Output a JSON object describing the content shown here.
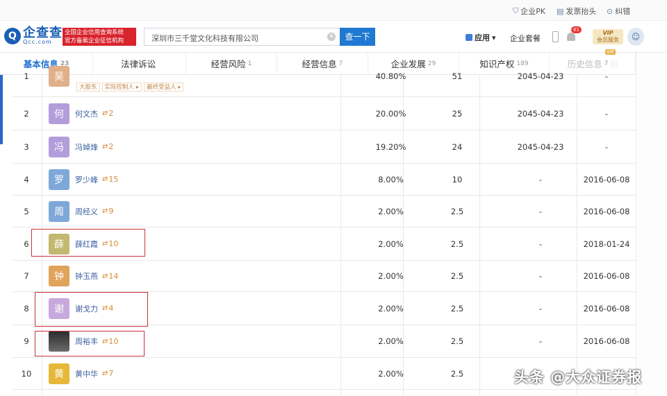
{
  "topbar": {
    "links": [
      {
        "label": "企业PK",
        "icon": "pk-icon"
      },
      {
        "label": "发票抬头",
        "icon": "invoice-icon"
      },
      {
        "label": "纠错",
        "icon": "correction-icon"
      }
    ]
  },
  "header": {
    "logo_main": "企查查",
    "logo_sub": "Qcc.com",
    "badge_line1": "全国企业信用查询系统",
    "badge_line2": "官方备案企业征信机构",
    "search_value": "深圳市三千堂文化科技有限公司",
    "search_button": "查一下",
    "app_label": "应用",
    "package_label": "企业套餐",
    "bell_count": "61",
    "vip_label": "VIP",
    "vip_sub": "会员服务"
  },
  "tabs": [
    {
      "label": "基本信息",
      "count": "23",
      "active": true
    },
    {
      "label": "法律诉讼",
      "count": ""
    },
    {
      "label": "经营风险",
      "count": "1"
    },
    {
      "label": "经营信息",
      "count": "7"
    },
    {
      "label": "企业发展",
      "count": "29"
    },
    {
      "label": "知识产权",
      "count": "189"
    },
    {
      "label": "历史信息",
      "count": "7",
      "vip": "VIP"
    }
  ],
  "rows": [
    {
      "index": "1",
      "avatar_char": "吴",
      "name": "",
      "relations": "",
      "percent": "40.80%",
      "amount": "51",
      "date1": "2045-04-23",
      "date2": "-",
      "tags": [
        "大股东",
        "实际控制人 ▸",
        "最终受益人 ▸"
      ]
    },
    {
      "index": "2",
      "avatar_char": "何",
      "name": "何文杰",
      "relations": "2",
      "percent": "20.00%",
      "amount": "25",
      "date1": "2045-04-23",
      "date2": "-"
    },
    {
      "index": "3",
      "avatar_char": "冯",
      "name": "冯婥烽",
      "relations": "2",
      "percent": "19.20%",
      "amount": "24",
      "date1": "2045-04-23",
      "date2": "-"
    },
    {
      "index": "4",
      "avatar_char": "罗",
      "name": "罗少峰",
      "relations": "15",
      "percent": "8.00%",
      "amount": "10",
      "date1": "-",
      "date2": "2016-06-08"
    },
    {
      "index": "5",
      "avatar_char": "周",
      "name": "周经义",
      "relations": "9",
      "percent": "2.00%",
      "amount": "2.5",
      "date1": "-",
      "date2": "2016-06-08"
    },
    {
      "index": "6",
      "avatar_char": "薛",
      "name": "薛红霞",
      "relations": "10",
      "percent": "2.00%",
      "amount": "2.5",
      "date1": "-",
      "date2": "2018-01-24"
    },
    {
      "index": "7",
      "avatar_char": "钟",
      "name": "钟玉燕",
      "relations": "14",
      "percent": "2.00%",
      "amount": "2.5",
      "date1": "-",
      "date2": "2016-06-08"
    },
    {
      "index": "8",
      "avatar_char": "谢",
      "name": "谢戈力",
      "relations": "4",
      "percent": "2.00%",
      "amount": "2.5",
      "date1": "-",
      "date2": "2016-06-08"
    },
    {
      "index": "9",
      "avatar_char": "",
      "name": "周裕丰",
      "relations": "10",
      "percent": "2.00%",
      "amount": "2.5",
      "date1": "-",
      "date2": "2016-06-08"
    },
    {
      "index": "10",
      "avatar_char": "黄",
      "name": "黄中华",
      "relations": "7",
      "percent": "2.00%",
      "amount": "2.5",
      "date1": "",
      "date2": ""
    }
  ],
  "colors": {
    "avatar_purple": "#b39ddb",
    "avatar_blue": "#7fa8d9",
    "avatar_olive": "#c2b870",
    "avatar_yellow": "#e6b83a",
    "highlight": "#c8323a"
  },
  "watermark": "头条 @大众证券报"
}
